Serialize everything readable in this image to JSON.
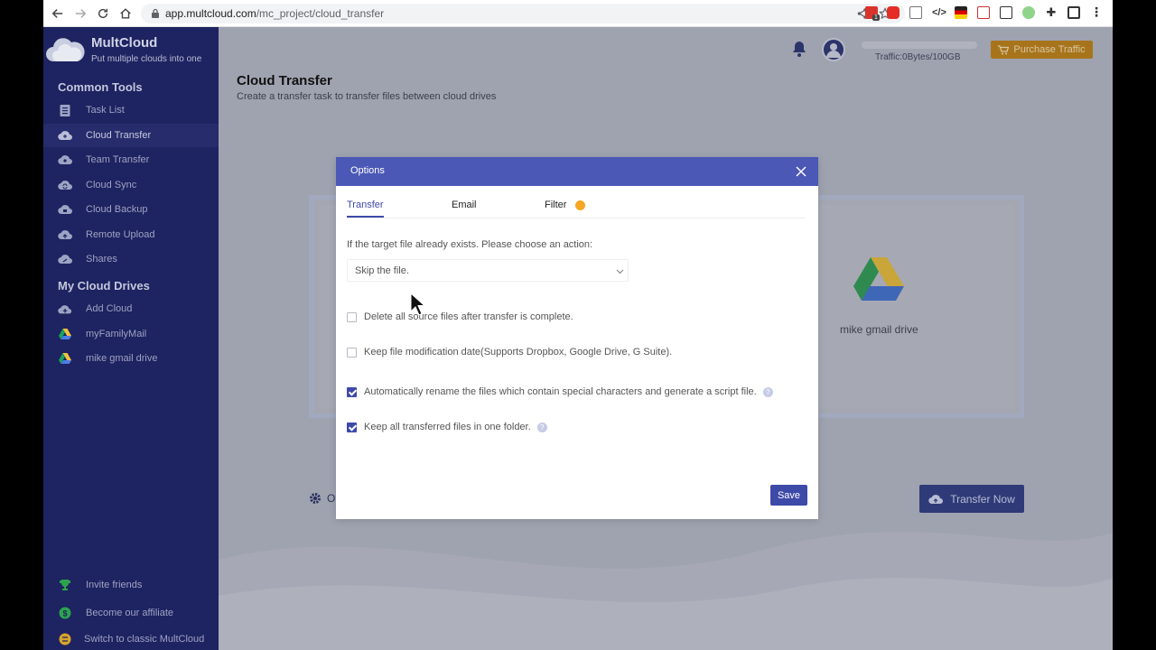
{
  "browser": {
    "url_host": "app.multcloud.com",
    "url_path": "/mc_project/cloud_transfer",
    "extension_badge": "1"
  },
  "app": {
    "brand": "MultCloud",
    "tagline": "Put multiple clouds into one"
  },
  "sidebar": {
    "common_tools_title": "Common Tools",
    "common_tools": [
      {
        "label": "Task List",
        "icon": "clipboard-icon"
      },
      {
        "label": "Cloud Transfer",
        "icon": "cloud-transfer-icon",
        "active": true
      },
      {
        "label": "Team Transfer",
        "icon": "team-transfer-icon"
      },
      {
        "label": "Cloud Sync",
        "icon": "cloud-sync-icon"
      },
      {
        "label": "Cloud Backup",
        "icon": "cloud-backup-icon"
      },
      {
        "label": "Remote Upload",
        "icon": "remote-upload-icon"
      },
      {
        "label": "Shares",
        "icon": "shares-icon"
      }
    ],
    "my_drives_title": "My Cloud Drives",
    "my_drives": [
      {
        "label": "Add Cloud",
        "icon": "add-cloud-icon"
      },
      {
        "label": "myFamilyMail",
        "icon": "google-drive-icon"
      },
      {
        "label": "mike gmail drive",
        "icon": "google-drive-icon"
      }
    ],
    "footer": [
      {
        "label": "Invite friends",
        "icon": "trophy-icon"
      },
      {
        "label": "Become our affiliate",
        "icon": "dollar-icon"
      },
      {
        "label": "Switch to classic MultCloud",
        "icon": "switch-icon"
      }
    ]
  },
  "header": {
    "traffic": "Traffic:0Bytes/100GB",
    "purchase_label": "Purchase Traffic"
  },
  "page": {
    "title": "Cloud Transfer",
    "subtitle": "Create a transfer task to transfer files between cloud drives",
    "target_drive": "mike gmail drive",
    "options_label": "O",
    "transfer_now_label": "Transfer Now"
  },
  "modal": {
    "title": "Options",
    "tabs": [
      "Transfer",
      "Email",
      "Filter"
    ],
    "question": "If the target file already exists. Please choose an action:",
    "select_value": "Skip the file.",
    "checks": [
      {
        "label": "Delete all source files after transfer is complete.",
        "checked": false,
        "help": false
      },
      {
        "label": "Keep file modification date(Supports Dropbox, Google Drive, G Suite).",
        "checked": false,
        "help": false
      },
      {
        "label": "Automatically rename the files which contain special characters and generate a script file.",
        "checked": true,
        "help": true
      },
      {
        "label": "Keep all transferred files in one folder.",
        "checked": true,
        "help": true
      }
    ],
    "save_label": "Save"
  },
  "colors": {
    "sidebar_bg": "#1e2361",
    "modal_header": "#4b58b5",
    "accent": "#3e4aa8",
    "purchase": "#a8741b"
  }
}
